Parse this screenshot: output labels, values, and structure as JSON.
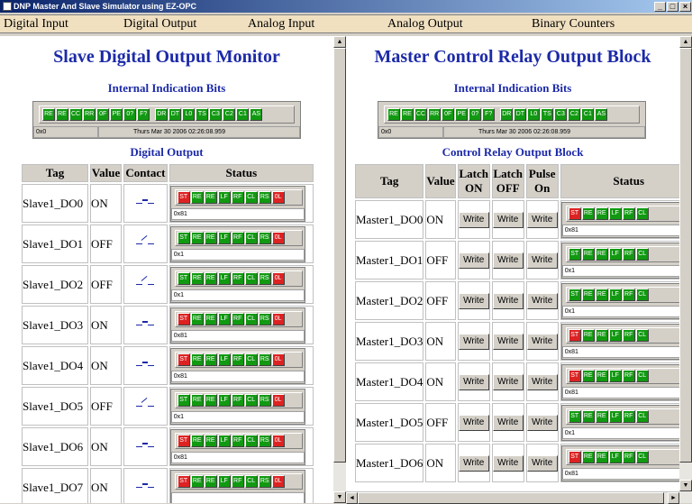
{
  "window": {
    "title": "DNP Master And Slave Simulator using EZ-OPC",
    "btn_min": "_",
    "btn_max": "□",
    "btn_close": "×"
  },
  "menu": [
    "Digital Input",
    "Digital Output",
    "Analog Input",
    "Analog Output",
    "Binary Counters"
  ],
  "left": {
    "title": "Slave Digital Output Monitor",
    "iib_heading": "Internal Indication Bits",
    "iib_bits_a": [
      "RE",
      "RE",
      "CC",
      "RR",
      "0F",
      "PE",
      "0?",
      "F?"
    ],
    "iib_bits_b": [
      "DR",
      "DT",
      "L0",
      "TS",
      "C3",
      "C2",
      "C1",
      "AS"
    ],
    "iib_value": "0x0",
    "iib_time": "Thurs Mar 30 2006 02:26:08.959",
    "table_heading": "Digital Output",
    "columns": [
      "Tag",
      "Value",
      "Contact",
      "Status"
    ],
    "rows": [
      {
        "tag": "Slave1_DO0",
        "value": "ON",
        "state": "on",
        "status": "0x81"
      },
      {
        "tag": "Slave1_DO1",
        "value": "OFF",
        "state": "off",
        "status": "0x1"
      },
      {
        "tag": "Slave1_DO2",
        "value": "OFF",
        "state": "off",
        "status": "0x1"
      },
      {
        "tag": "Slave1_DO3",
        "value": "ON",
        "state": "on",
        "status": "0x81"
      },
      {
        "tag": "Slave1_DO4",
        "value": "ON",
        "state": "on",
        "status": "0x81"
      },
      {
        "tag": "Slave1_DO5",
        "value": "OFF",
        "state": "off",
        "status": "0x1"
      },
      {
        "tag": "Slave1_DO6",
        "value": "ON",
        "state": "on",
        "status": "0x81"
      },
      {
        "tag": "Slave1_DO7",
        "value": "ON",
        "state": "on",
        "status": ""
      }
    ]
  },
  "right": {
    "title": "Master Control Relay Output Block",
    "iib_heading": "Internal Indication Bits",
    "iib_value": "0x0",
    "iib_time": "Thurs Mar 30 2006 02:26:08.959",
    "table_heading": "Control Relay Output Block",
    "columns": [
      "Tag",
      "Value",
      "Latch ON",
      "Latch OFF",
      "Pulse On",
      "Status"
    ],
    "write_label": "Write",
    "rows": [
      {
        "tag": "Master1_DO0",
        "value": "ON",
        "state": "on",
        "status": "0x81"
      },
      {
        "tag": "Master1_DO1",
        "value": "OFF",
        "state": "off",
        "status": "0x1"
      },
      {
        "tag": "Master1_DO2",
        "value": "OFF",
        "state": "off",
        "status": "0x1"
      },
      {
        "tag": "Master1_DO3",
        "value": "ON",
        "state": "on",
        "status": "0x81"
      },
      {
        "tag": "Master1_DO4",
        "value": "ON",
        "state": "on",
        "status": "0x81"
      },
      {
        "tag": "Master1_DO5",
        "value": "OFF",
        "state": "off",
        "status": "0x1"
      },
      {
        "tag": "Master1_DO6",
        "value": "ON",
        "state": "on",
        "status": "0x81"
      }
    ]
  },
  "status_bits_left": [
    "ST",
    "RE",
    "RE",
    "LF",
    "RF",
    "CL",
    "RS",
    "0L"
  ],
  "status_bits_right": [
    "ST",
    "RE",
    "RE",
    "LF",
    "RF",
    "CL"
  ],
  "colors": {
    "on": "#dd2222",
    "ok": "#119911",
    "heading": "#1c2aa8"
  }
}
